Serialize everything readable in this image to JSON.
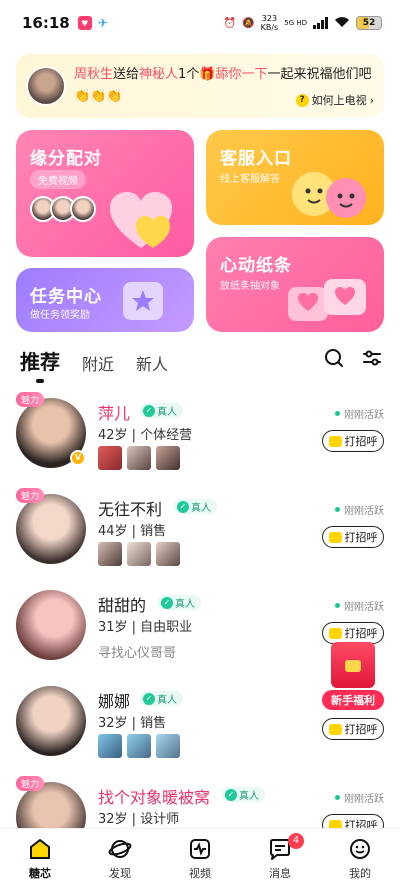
{
  "status": {
    "time": "16:18",
    "speed_value": "323",
    "speed_unit": "KB/s",
    "network": "5G HD",
    "battery": "52",
    "battery_level": 0.52
  },
  "banner": {
    "sender": "周秋生",
    "action": "送给",
    "receiver": "神秘人",
    "count": "1个",
    "gift": "舔你一下",
    "message": "一起来祝福他们吧",
    "hands": "👏👏👏",
    "tv_link": "如何上电视"
  },
  "cards": {
    "match": {
      "title": "缘分配对",
      "sub": "免费视频"
    },
    "service": {
      "title": "客服入口",
      "sub": "线上客服解答"
    },
    "task": {
      "title": "任务中心",
      "sub": "做任务领奖励"
    },
    "note": {
      "title": "心动纸条",
      "sub": "放纸条抽对象"
    }
  },
  "tabs": {
    "recommend": "推荐",
    "nearby": "附近",
    "newcomer": "新人"
  },
  "list": {
    "charm": "魅力",
    "verified": "真人",
    "active": "刚刚活跃",
    "greet": "打招呼",
    "users": [
      {
        "name": "萍儿",
        "info": "42岁 | 个体经营"
      },
      {
        "name": "无往不利",
        "info": "44岁 | 销售"
      },
      {
        "name": "甜甜的",
        "info": "31岁 | 自由职业",
        "seek": "寻找心仪哥哥"
      },
      {
        "name": "娜娜",
        "info": "32岁 | 销售"
      },
      {
        "name": "找个对象暖被窝",
        "info": "32岁 | 设计师"
      }
    ]
  },
  "welfare": {
    "label": "新手福利"
  },
  "nav": {
    "items": [
      {
        "label": "糖芯"
      },
      {
        "label": "发现"
      },
      {
        "label": "视频"
      },
      {
        "label": "消息",
        "badge": "4"
      },
      {
        "label": "我的"
      }
    ]
  }
}
